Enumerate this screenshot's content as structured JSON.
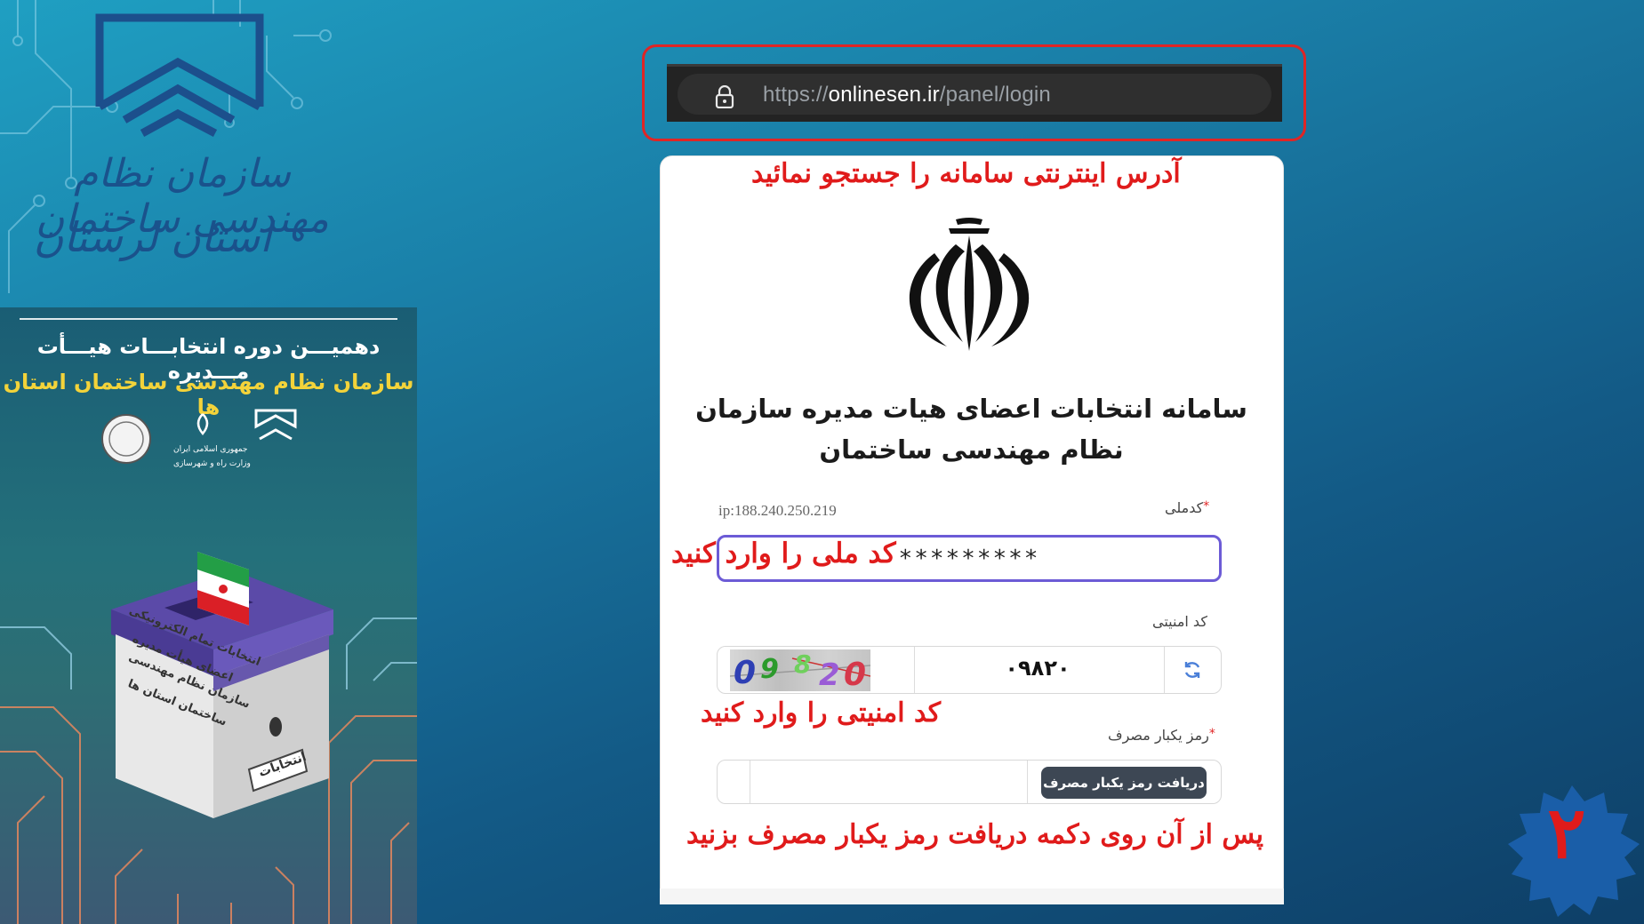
{
  "browser": {
    "url_scheme": "https://",
    "url_host": "onlinesen.ir",
    "url_path": "/panel/login",
    "icon": "lock-icon"
  },
  "branding": {
    "org_line1": "سازمان نظام مهندسی ساختمان",
    "org_line2": "استان لرستان"
  },
  "poster": {
    "title": "دهمیـــن دوره انتخابـــات هیـــأت مـــدیره",
    "subtitle": "سازمان نظام مهندسی ساختمان استان ها",
    "ministry_line1": "جمهوری اسلامی ایران",
    "ministry_line2": "وزارت راه و شهرسازی",
    "ballot_text": [
      "انتخابات تمام الکترونیکی",
      "اعضای هیأت مدیره",
      "سازمان نظام مهندسی",
      "ساختمان استان ها"
    ],
    "box_label": "انتخابات"
  },
  "instructions": {
    "search_address": "آدرس اینترنتی سامانه را جستجو نمائید",
    "enter_national_code": "کد ملی را وارد کنید",
    "enter_security_code": "کد امنیتی را وارد کنید",
    "press_otp": "پس از آن روی دکمه دریافت رمز یکبار مصرف بزنید"
  },
  "login": {
    "system_title_line1": "سامانه انتخابات اعضای هیات مدیره سازمان",
    "system_title_line2": "نظام مهندسی ساختمان",
    "national_code_label": "کدملی",
    "required_mark": "*",
    "ip_text": "ip:188.240.250.219",
    "national_code_value": "*********",
    "security_code_label": "کد امنیتی",
    "captcha_image_text": "09820",
    "captcha_value": "۰۹۸۲۰",
    "otp_label": "رمز یکبار مصرف",
    "otp_button": "دریافت رمز یکبار مصرف"
  },
  "step": {
    "number": "۲"
  },
  "colors": {
    "instruction_red": "#e01b1b",
    "highlight_red": "#e02525",
    "input_focus": "#6c5bd6",
    "button_dark": "#3d4754"
  }
}
